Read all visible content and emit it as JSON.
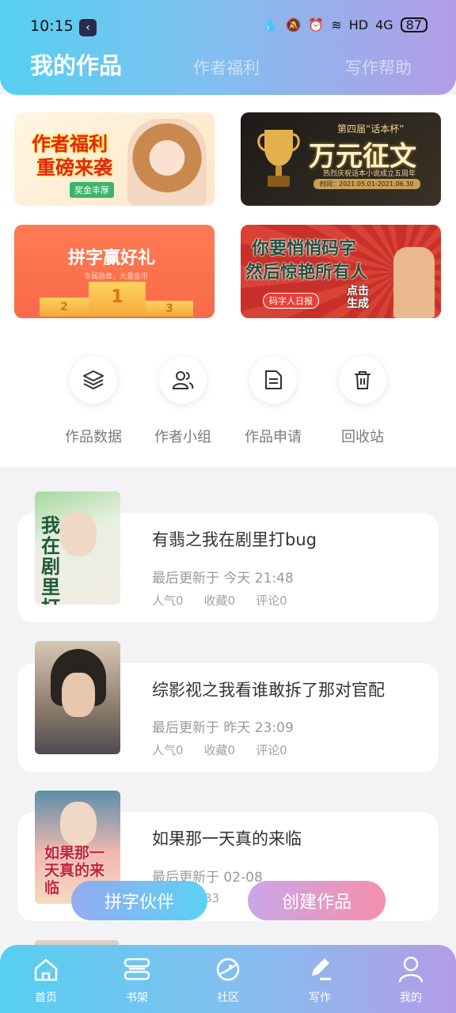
{
  "status": {
    "time": "10:15",
    "network": "HD",
    "signal": "4G",
    "battery": "87"
  },
  "header": {
    "title": "我的作品",
    "tabs": [
      {
        "label": "作者福利"
      },
      {
        "label": "写作帮助"
      }
    ]
  },
  "banners": [
    {
      "line1": "作者福利",
      "line2": "重磅来袭",
      "tag": "奖金丰厚"
    },
    {
      "top": "第四届“话本杯”",
      "title": "万元征文",
      "subtitle": "热烈庆祝话本小说成立五周年",
      "date": "时间：2021.05.01-2021.06.30"
    },
    {
      "title": "拼字赢好礼",
      "subtitle": "专属勋章，大量金币",
      "podium": [
        "2",
        "1",
        "3"
      ]
    },
    {
      "line1": "你要悄悄码字",
      "line2": "然后惊艳所有人",
      "pill": "码字人日报",
      "cta": "点击生成"
    }
  ],
  "quick_actions": [
    {
      "label": "作品数据",
      "icon": "layers-icon"
    },
    {
      "label": "作者小组",
      "icon": "users-icon"
    },
    {
      "label": "作品申请",
      "icon": "document-icon"
    },
    {
      "label": "回收站",
      "icon": "trash-icon"
    }
  ],
  "works": [
    {
      "cover_text": "我在剧里打bug",
      "title": "有翡之我在剧里打bug",
      "updated": "最后更新于 今天 21:48",
      "stats": [
        "人气0",
        "收藏0",
        "评论0"
      ]
    },
    {
      "cover_text": "",
      "title": "综影视之我看谁敢拆了那对官配",
      "updated": "最后更新于 昨天 23:09",
      "stats": [
        "人气0",
        "收藏0",
        "评论0"
      ]
    },
    {
      "cover_text": "如果那一天真的来临",
      "title": "如果那一天真的来临",
      "updated": "最后更新于 02-08",
      "stats": [
        "83"
      ]
    }
  ],
  "fab": {
    "left": "拼字伙伴",
    "right": "创建作品"
  },
  "bottom_nav": [
    {
      "label": "首页",
      "icon": "home-icon"
    },
    {
      "label": "书架",
      "icon": "bookshelf-icon"
    },
    {
      "label": "社区",
      "icon": "planet-icon"
    },
    {
      "label": "写作",
      "icon": "pen-icon"
    },
    {
      "label": "我的",
      "icon": "profile-icon"
    }
  ],
  "colors": {
    "gradient_start": "#56cff1",
    "gradient_end": "#b39ce6",
    "create_button": "#f58aa6"
  }
}
